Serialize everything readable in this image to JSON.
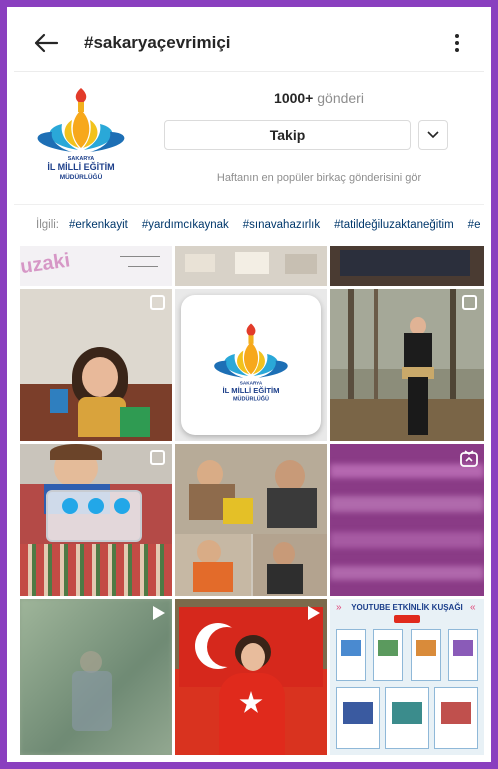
{
  "header": {
    "title": "#sakaryaçevrimiçi",
    "back_icon": "arrow-left-icon",
    "more_icon": "vertical-dots-icon"
  },
  "profile": {
    "logo": {
      "line1": "SAKARYA",
      "line2": "İL MİLLİ EĞİTİM",
      "line3": "MÜDÜRLÜĞÜ"
    },
    "post_count": "1000+",
    "post_label": "gönderi",
    "follow_label": "Takip",
    "hint": "Haftanın en popüler birkaç gönderisini gör"
  },
  "related": {
    "label": "İlgili:",
    "tags": [
      "#erkenkayit",
      "#yardımcıkaynak",
      "#sınavahazırlık",
      "#tatildeğiluzaktaneğitim",
      "#e"
    ]
  },
  "grid": {
    "youtube": {
      "title": "YOUTUBE ETKİNLİK KUŞAĞI"
    }
  },
  "colors": {
    "frame": "#8a3fbf",
    "link": "#00376b",
    "muted": "#8e8e8e"
  }
}
